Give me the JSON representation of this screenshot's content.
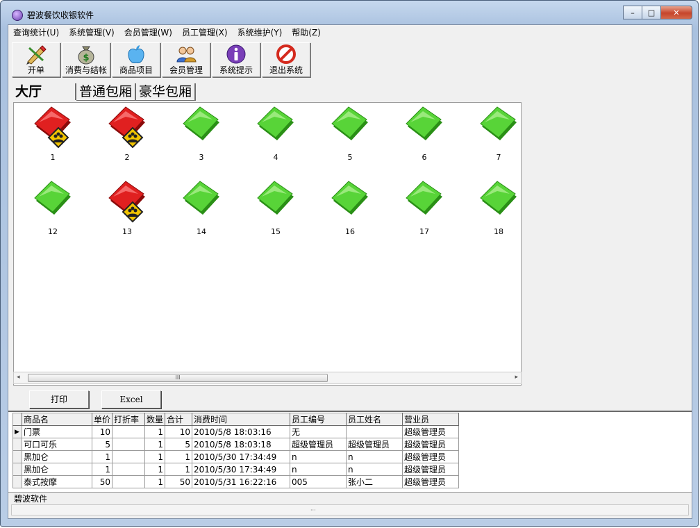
{
  "window": {
    "title": "碧波餐饮收银软件",
    "minimize": "–",
    "maximize": "□",
    "close": "✕"
  },
  "menu": [
    "查询统计(U)",
    "系统管理(V)",
    "会员管理(W)",
    "员工管理(X)",
    "系统维护(Y)",
    "帮助(Z)"
  ],
  "toolbar": [
    {
      "label": "开单",
      "icon": "pen-icon"
    },
    {
      "label": "消费与结帐",
      "icon": "money-bag-icon"
    },
    {
      "label": "商品项目",
      "icon": "apple-icon"
    },
    {
      "label": "会员管理",
      "icon": "members-icon"
    },
    {
      "label": "系统提示",
      "icon": "info-icon"
    },
    {
      "label": "退出系统",
      "icon": "no-entry-icon"
    }
  ],
  "tabs": [
    "大厅",
    "普通包厢",
    "豪华包厢"
  ],
  "tables": [
    {
      "num": "1",
      "occupied": true
    },
    {
      "num": "2",
      "occupied": true
    },
    {
      "num": "3",
      "occupied": false
    },
    {
      "num": "4",
      "occupied": false
    },
    {
      "num": "5",
      "occupied": false
    },
    {
      "num": "6",
      "occupied": false
    },
    {
      "num": "7",
      "occupied": false
    },
    {
      "num": "12",
      "occupied": false
    },
    {
      "num": "13",
      "occupied": true
    },
    {
      "num": "14",
      "occupied": false
    },
    {
      "num": "15",
      "occupied": false
    },
    {
      "num": "16",
      "occupied": false
    },
    {
      "num": "17",
      "occupied": false
    },
    {
      "num": "18",
      "occupied": false
    }
  ],
  "scroll": {
    "left": "◂",
    "right": "▸",
    "grip": "III",
    "bottom_grip": "···"
  },
  "buttons": {
    "print": "打印",
    "excel": "Excel"
  },
  "grid": {
    "headers": [
      "商品名",
      "单价",
      "打折率",
      "数量",
      "合计",
      "消费时间",
      "员工编号",
      "员工姓名",
      "营业员"
    ],
    "rows": [
      [
        "门票",
        "10",
        "",
        "1",
        "10",
        "2010/5/8 18:03:16",
        "无",
        "",
        "超级管理员"
      ],
      [
        "可口可乐",
        "5",
        "",
        "1",
        "5",
        "2010/5/8 18:03:18",
        "超级管理员",
        "超级管理员",
        "超级管理员"
      ],
      [
        "黑加仑",
        "1",
        "",
        "1",
        "1",
        "2010/5/30 17:34:49",
        "n",
        "n",
        "超级管理员"
      ],
      [
        "黑加仑",
        "1",
        "",
        "1",
        "1",
        "2010/5/30 17:34:49",
        "n",
        "n",
        "超级管理员"
      ],
      [
        "泰式按摩",
        "50",
        "",
        "1",
        "50",
        "2010/5/31 16:22:16",
        "005",
        "张小二",
        "超级管理员"
      ]
    ],
    "current_row_marker": "▶"
  },
  "status": "碧波软件"
}
